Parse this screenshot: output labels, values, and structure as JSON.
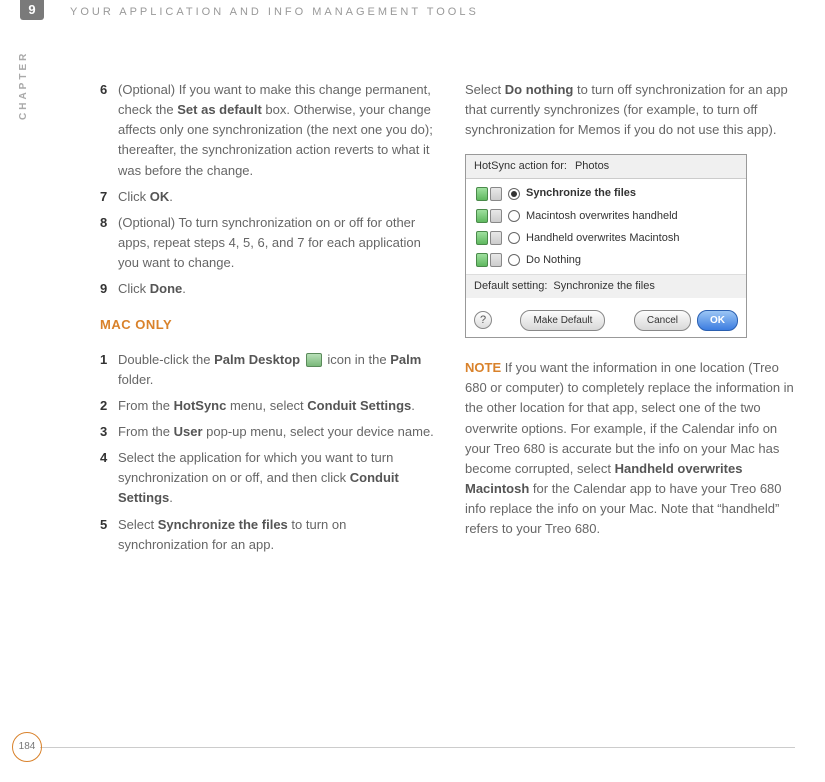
{
  "header": {
    "chapter_number": "9",
    "chapter_label": "CHAPTER",
    "title": "YOUR APPLICATION AND INFO MANAGEMENT TOOLS"
  },
  "left_steps_a": [
    {
      "num": "6",
      "html": "(Optional)  If you want to make this change permanent, check the <b>Set as default</b> box. Otherwise, your change affects only one synchronization (the next one you do); thereafter, the synchronization action reverts to what it was before the change."
    },
    {
      "num": "7",
      "html": "Click <b>OK</b>."
    },
    {
      "num": "8",
      "html": "(Optional)  To turn synchronization on or off for other apps, repeat steps 4, 5, 6, and 7 for each application you want to change."
    },
    {
      "num": "9",
      "html": "Click <b>Done</b>."
    }
  ],
  "mac_only_label": "MAC ONLY",
  "left_steps_b": [
    {
      "num": "1",
      "html": "Double-click the <b>Palm Desktop</b> <span class=\"inline-icon\" data-name=\"palm-desktop-icon\" data-interactable=\"false\"></span> icon in the <b>Palm</b> folder."
    },
    {
      "num": "2",
      "html": "From the <b>HotSync</b> menu, select <b>Conduit Settings</b>."
    },
    {
      "num": "3",
      "html": "From the <b>User</b> pop-up menu, select your device name."
    },
    {
      "num": "4",
      "html": "Select the application for which you want to turn synchronization on or off, and then click <b>Conduit Settings</b>."
    },
    {
      "num": "5",
      "html": "Select <b>Synchronize the files</b> to turn on synchronization for an app."
    }
  ],
  "right_intro_html": "Select <b>Do nothing</b> to turn off synchronization for an app that currently synchronizes (for example, to turn off synchronization for Memos if you do not use this app).",
  "dialog": {
    "header_label": "HotSync action for:",
    "header_value": "Photos",
    "options": [
      {
        "label": "Synchronize the files",
        "selected": true
      },
      {
        "label": "Macintosh overwrites handheld",
        "selected": false
      },
      {
        "label": "Handheld overwrites Macintosh",
        "selected": false
      },
      {
        "label": "Do Nothing",
        "selected": false
      }
    ],
    "default_label": "Default setting:",
    "default_value": "Synchronize the files",
    "help": "?",
    "make_default": "Make Default",
    "cancel": "Cancel",
    "ok": "OK"
  },
  "note_label": "NOTE",
  "note_html": "If you want the information in one location (Treo 680 or computer) to completely replace the information in the other location for that app, select one of the two overwrite options. For example, if the Calendar info on your Treo 680 is accurate but the info on your Mac has become corrupted, select <b>Handheld overwrites Macintosh</b> for the Calendar app to have your Treo 680 info replace the info on your Mac. Note that “handheld” refers to your Treo 680.",
  "page_number": "184"
}
